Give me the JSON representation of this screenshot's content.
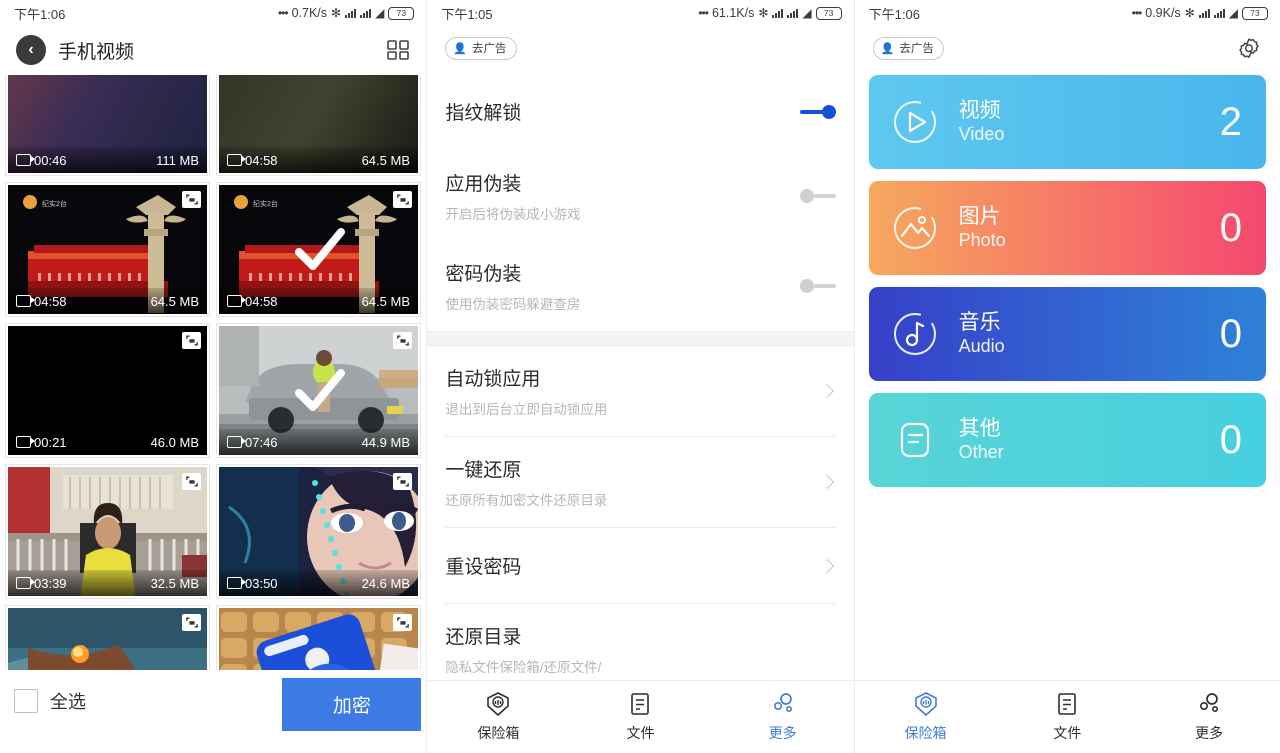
{
  "panel1": {
    "status": {
      "time": "下午1:06",
      "dots": "•••",
      "speed": "0.7K/s",
      "battery": "73"
    },
    "header": {
      "title": "手机视频",
      "back_icon": "back-chevron-icon",
      "grid_icon": "grid-view-icon"
    },
    "videos": [
      {
        "duration": "00:46",
        "size": "111 MB",
        "selected": false
      },
      {
        "duration": "04:58",
        "size": "64.5 MB",
        "selected": false
      },
      {
        "duration": "04:58",
        "size": "64.5 MB",
        "selected": false
      },
      {
        "duration": "04:58",
        "size": "64.5 MB",
        "selected": true
      },
      {
        "duration": "00:21",
        "size": "46.0 MB",
        "selected": false
      },
      {
        "duration": "07:46",
        "size": "44.9 MB",
        "selected": true
      },
      {
        "duration": "03:39",
        "size": "32.5 MB",
        "selected": false
      },
      {
        "duration": "03:50",
        "size": "24.6 MB",
        "selected": false
      },
      {
        "duration": "",
        "size": "",
        "selected": false
      },
      {
        "duration": "",
        "size": "",
        "selected": false
      }
    ],
    "footer": {
      "select_all": "全选",
      "encrypt": "加密",
      "encrypt_color": "#3c7ae4"
    }
  },
  "panel2": {
    "status": {
      "time": "下午1:05",
      "dots": "•••",
      "speed": "61.1K/s",
      "battery": "73"
    },
    "ad_pill": "去广告",
    "settings": [
      {
        "title": "指纹解锁",
        "sub": "",
        "control": "switch",
        "on": true
      },
      {
        "title": "应用伪装",
        "sub": "开启后将伪装成小游戏",
        "control": "switch",
        "on": false
      },
      {
        "title": "密码伪装",
        "sub": "使用伪装密码躲避查房",
        "control": "switch",
        "on": false
      },
      {
        "title": "自动锁应用",
        "sub": "退出到后台立即自动锁应用",
        "control": "chevron",
        "on": false
      },
      {
        "title": "一键还原",
        "sub": "还原所有加密文件还原目录",
        "control": "chevron",
        "on": false
      },
      {
        "title": "重设密码",
        "sub": "",
        "control": "chevron",
        "on": false
      },
      {
        "title": "还原目录",
        "sub": "隐私文件保险箱/还原文件/",
        "control": "",
        "on": false
      }
    ],
    "nav": [
      {
        "label": "保险箱",
        "icon": "vault-shield-icon",
        "active": false
      },
      {
        "label": "文件",
        "icon": "file-document-icon",
        "active": false
      },
      {
        "label": "更多",
        "icon": "more-dots-icon",
        "active": true
      }
    ],
    "accent": "#3e7ddc"
  },
  "panel3": {
    "status": {
      "time": "下午1:06",
      "dots": "•••",
      "speed": "0.9K/s",
      "battery": "73"
    },
    "ad_pill": "去广告",
    "gear_icon": "gear-settings-icon",
    "cards": [
      {
        "cn": "视频",
        "en": "Video",
        "count": "2",
        "icon": "play-circle-icon",
        "from": "#5ec8ef",
        "to": "#49b6ec"
      },
      {
        "cn": "图片",
        "en": "Photo",
        "count": "0",
        "icon": "photo-mountain-icon",
        "from": "#f6a95e",
        "to": "#f5486f"
      },
      {
        "cn": "音乐",
        "en": "Audio",
        "count": "0",
        "icon": "music-disc-icon",
        "from": "#3640c8",
        "to": "#2f82d8"
      },
      {
        "cn": "其他",
        "en": "Other",
        "count": "0",
        "icon": "document-lines-icon",
        "from": "#58d4d6",
        "to": "#46d0e0"
      }
    ],
    "nav": [
      {
        "label": "保险箱",
        "icon": "vault-shield-icon",
        "active": true
      },
      {
        "label": "文件",
        "icon": "file-document-icon",
        "active": false
      },
      {
        "label": "更多",
        "icon": "more-dots-icon",
        "active": false
      }
    ],
    "accent": "#3e7ddc"
  }
}
